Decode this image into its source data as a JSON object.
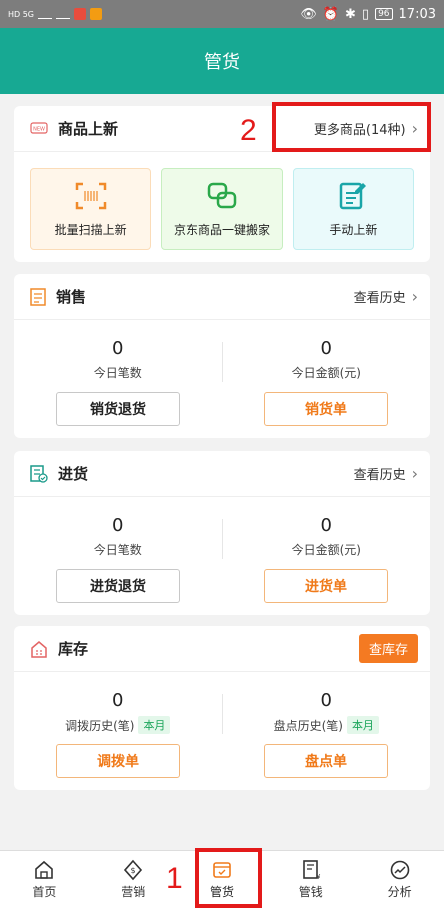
{
  "status_bar": {
    "left_text": "HD 5G",
    "time": "17:03",
    "battery": "96"
  },
  "header": {
    "title": "管货"
  },
  "new_products": {
    "title": "商品上新",
    "more_link": "更多商品(14种)",
    "tiles": [
      {
        "label": "批量扫描上新",
        "icon": "scan-icon",
        "color": "#f08a2a"
      },
      {
        "label": "京东商品一键搬家",
        "icon": "move-icon",
        "color": "#2aa84a"
      },
      {
        "label": "手动上新",
        "icon": "edit-doc-icon",
        "color": "#1aa5a8"
      }
    ]
  },
  "sales": {
    "title": "销售",
    "history_link": "查看历史",
    "stats": [
      {
        "value": "0",
        "label": "今日笔数"
      },
      {
        "value": "0",
        "label": "今日金额(元)"
      }
    ],
    "buttons": [
      "销货退货",
      "销货单"
    ]
  },
  "purchase": {
    "title": "进货",
    "history_link": "查看历史",
    "stats": [
      {
        "value": "0",
        "label": "今日笔数"
      },
      {
        "value": "0",
        "label": "今日金额(元)"
      }
    ],
    "buttons": [
      "进货退货",
      "进货单"
    ]
  },
  "inventory": {
    "title": "库存",
    "check_button": "查库存",
    "stats": [
      {
        "value": "0",
        "label": "调拨历史(笔)",
        "tag": "本月"
      },
      {
        "value": "0",
        "label": "盘点历史(笔)",
        "tag": "本月"
      }
    ],
    "buttons": [
      "调拨单",
      "盘点单"
    ]
  },
  "tabbar": {
    "items": [
      {
        "label": "首页",
        "icon": "home-icon"
      },
      {
        "label": "营销",
        "icon": "marketing-icon"
      },
      {
        "label": "管货",
        "icon": "goods-icon",
        "active": true
      },
      {
        "label": "管钱",
        "icon": "money-icon"
      },
      {
        "label": "分析",
        "icon": "analysis-icon"
      }
    ]
  },
  "annotations": {
    "label_1": "1",
    "label_2": "2"
  },
  "colors": {
    "brand": "#17a993",
    "accent": "#f47a22",
    "highlight": "#e31a1a"
  }
}
